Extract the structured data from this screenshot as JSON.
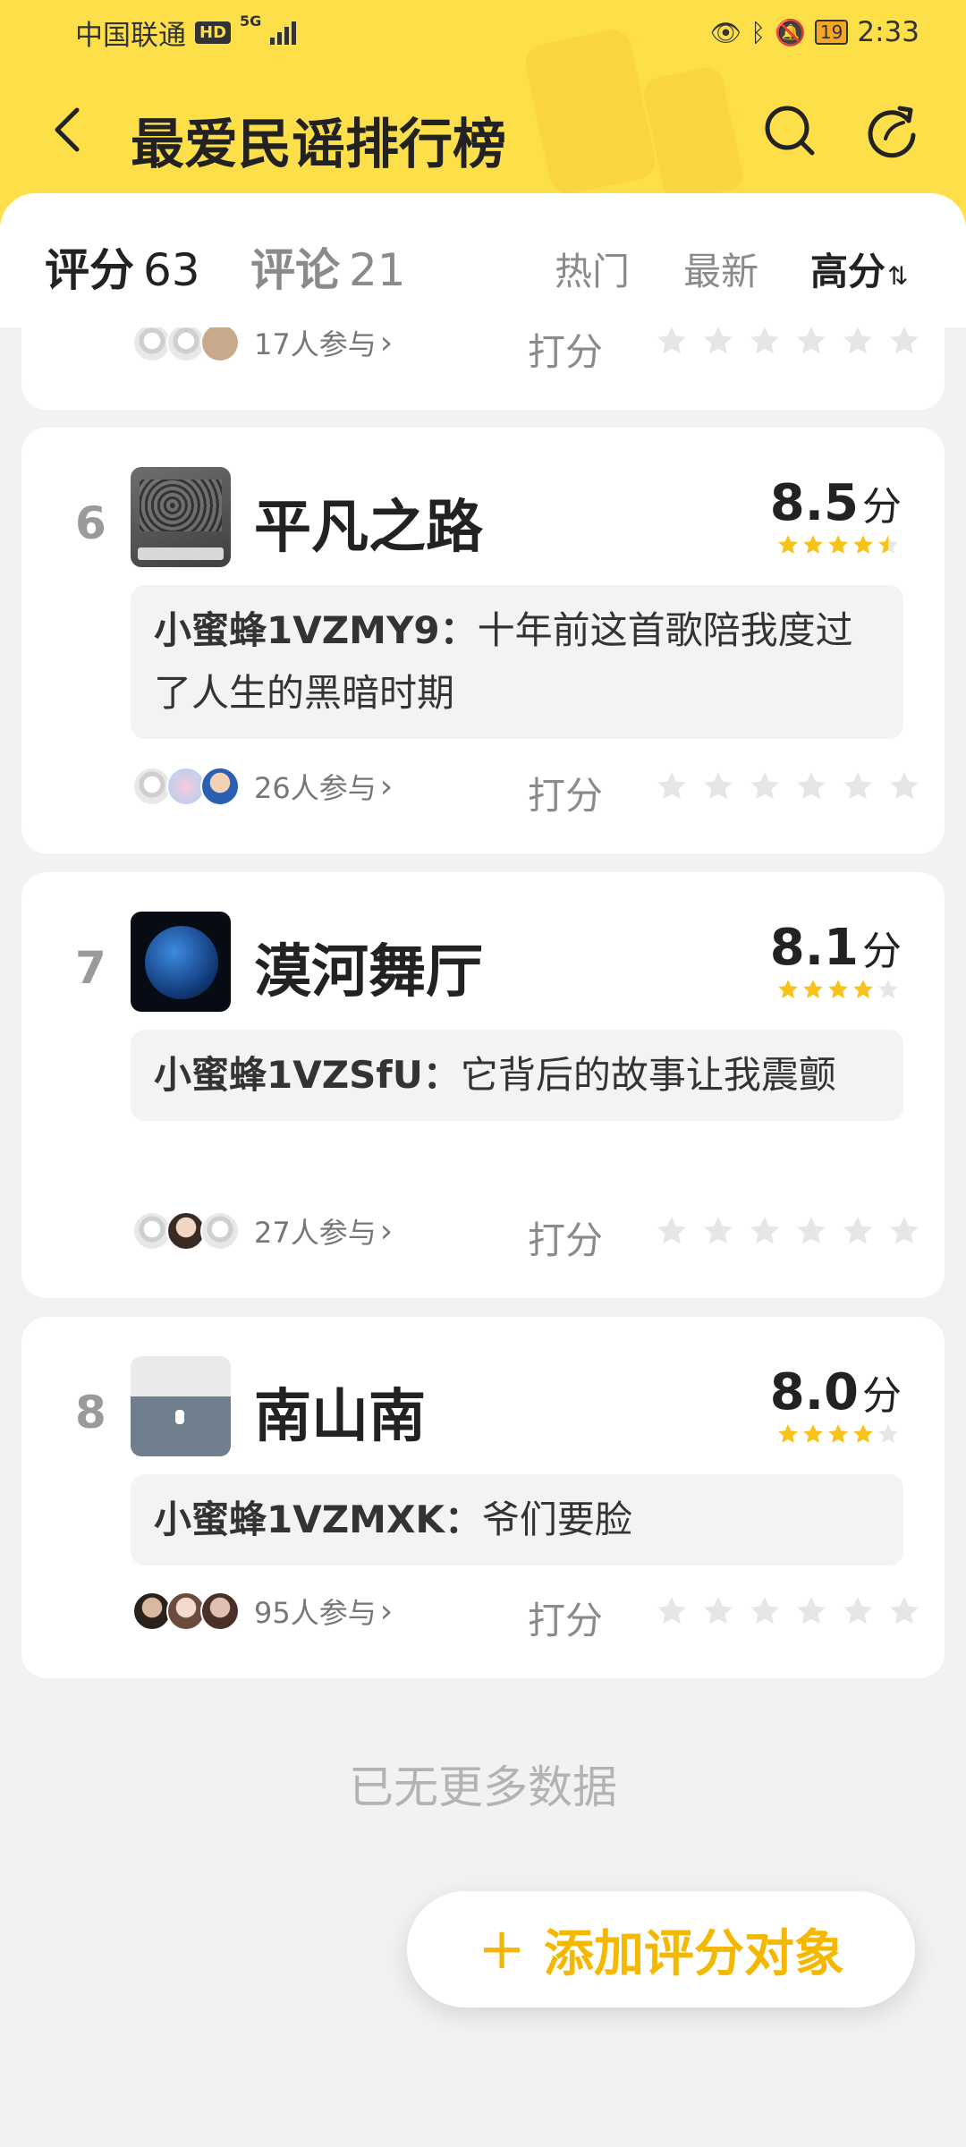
{
  "status": {
    "carrier": "中国联通",
    "hd": "HD",
    "network": "5G",
    "battery": "19",
    "time": "2:33"
  },
  "nav": {
    "title": "最爱民谣排行榜"
  },
  "tabs": {
    "score_label": "评分",
    "score_count": "63",
    "comment_label": "评论",
    "comment_count": "21",
    "sort_hot": "热门",
    "sort_new": "最新",
    "sort_high": "高分",
    "sort_arrow": "⇅"
  },
  "partial_card": {
    "participants": "17人参与",
    "rate_label": "打分"
  },
  "items": [
    {
      "rank": "6",
      "name": "平凡之路",
      "score": "8.5",
      "unit": "分",
      "stars": 4.5,
      "comment_user": "小蜜蜂1VZMY9：",
      "comment_text": "十年前这首歌陪我度过了人生的黑暗时期",
      "participants": "26人参与",
      "rate_label": "打分"
    },
    {
      "rank": "7",
      "name": "漠河舞厅",
      "score": "8.1",
      "unit": "分",
      "stars": 4,
      "comment_user": "小蜜蜂1VZSfU：",
      "comment_text": "它背后的故事让我震颤",
      "participants": "27人参与",
      "rate_label": "打分"
    },
    {
      "rank": "8",
      "name": "南山南",
      "score": "8.0",
      "unit": "分",
      "stars": 4,
      "comment_user": "小蜜蜂1VZMXK：",
      "comment_text": "爷们要脸",
      "participants": "95人参与",
      "rate_label": "打分"
    }
  ],
  "footer": {
    "no_more": "已无更多数据",
    "add_button": "添加评分对象",
    "add_plus": "+"
  },
  "colors": {
    "brand_yellow": "#fddf4a",
    "star_gold": "#f7c31a",
    "star_empty": "#e6e6e6",
    "add_text": "#f5b800"
  }
}
